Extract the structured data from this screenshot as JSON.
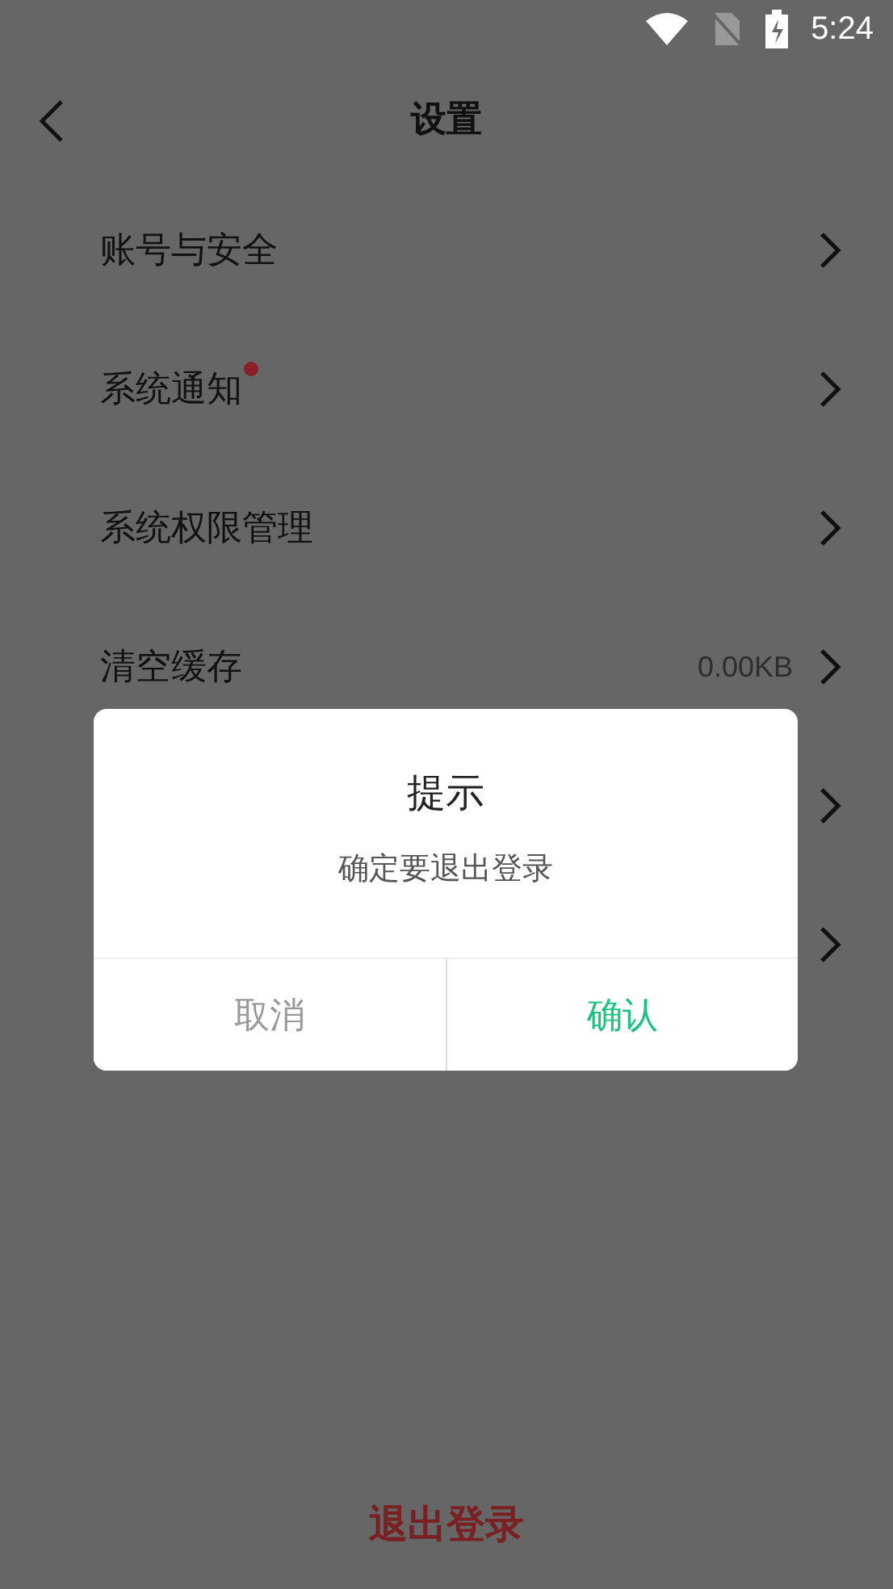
{
  "status_bar": {
    "time": "5:24"
  },
  "header": {
    "title": "设置"
  },
  "settings": [
    {
      "kind": "entry",
      "label": "账号与安全",
      "badge": false
    },
    {
      "kind": "entry",
      "label": "系统通知",
      "badge": true
    },
    {
      "kind": "entry",
      "label": "系统权限管理",
      "badge": false
    },
    {
      "kind": "entry",
      "label": "清空缓存",
      "badge": false,
      "value": "0.00KB"
    },
    {
      "kind": "covered"
    },
    {
      "kind": "covered"
    }
  ],
  "dialog": {
    "title": "提示",
    "message": "确定要退出登录",
    "buttons": [
      {
        "label": "取消",
        "kind": "cancel"
      },
      {
        "label": "确认",
        "kind": "confirm"
      }
    ]
  },
  "logout": {
    "label": "退出登录"
  }
}
